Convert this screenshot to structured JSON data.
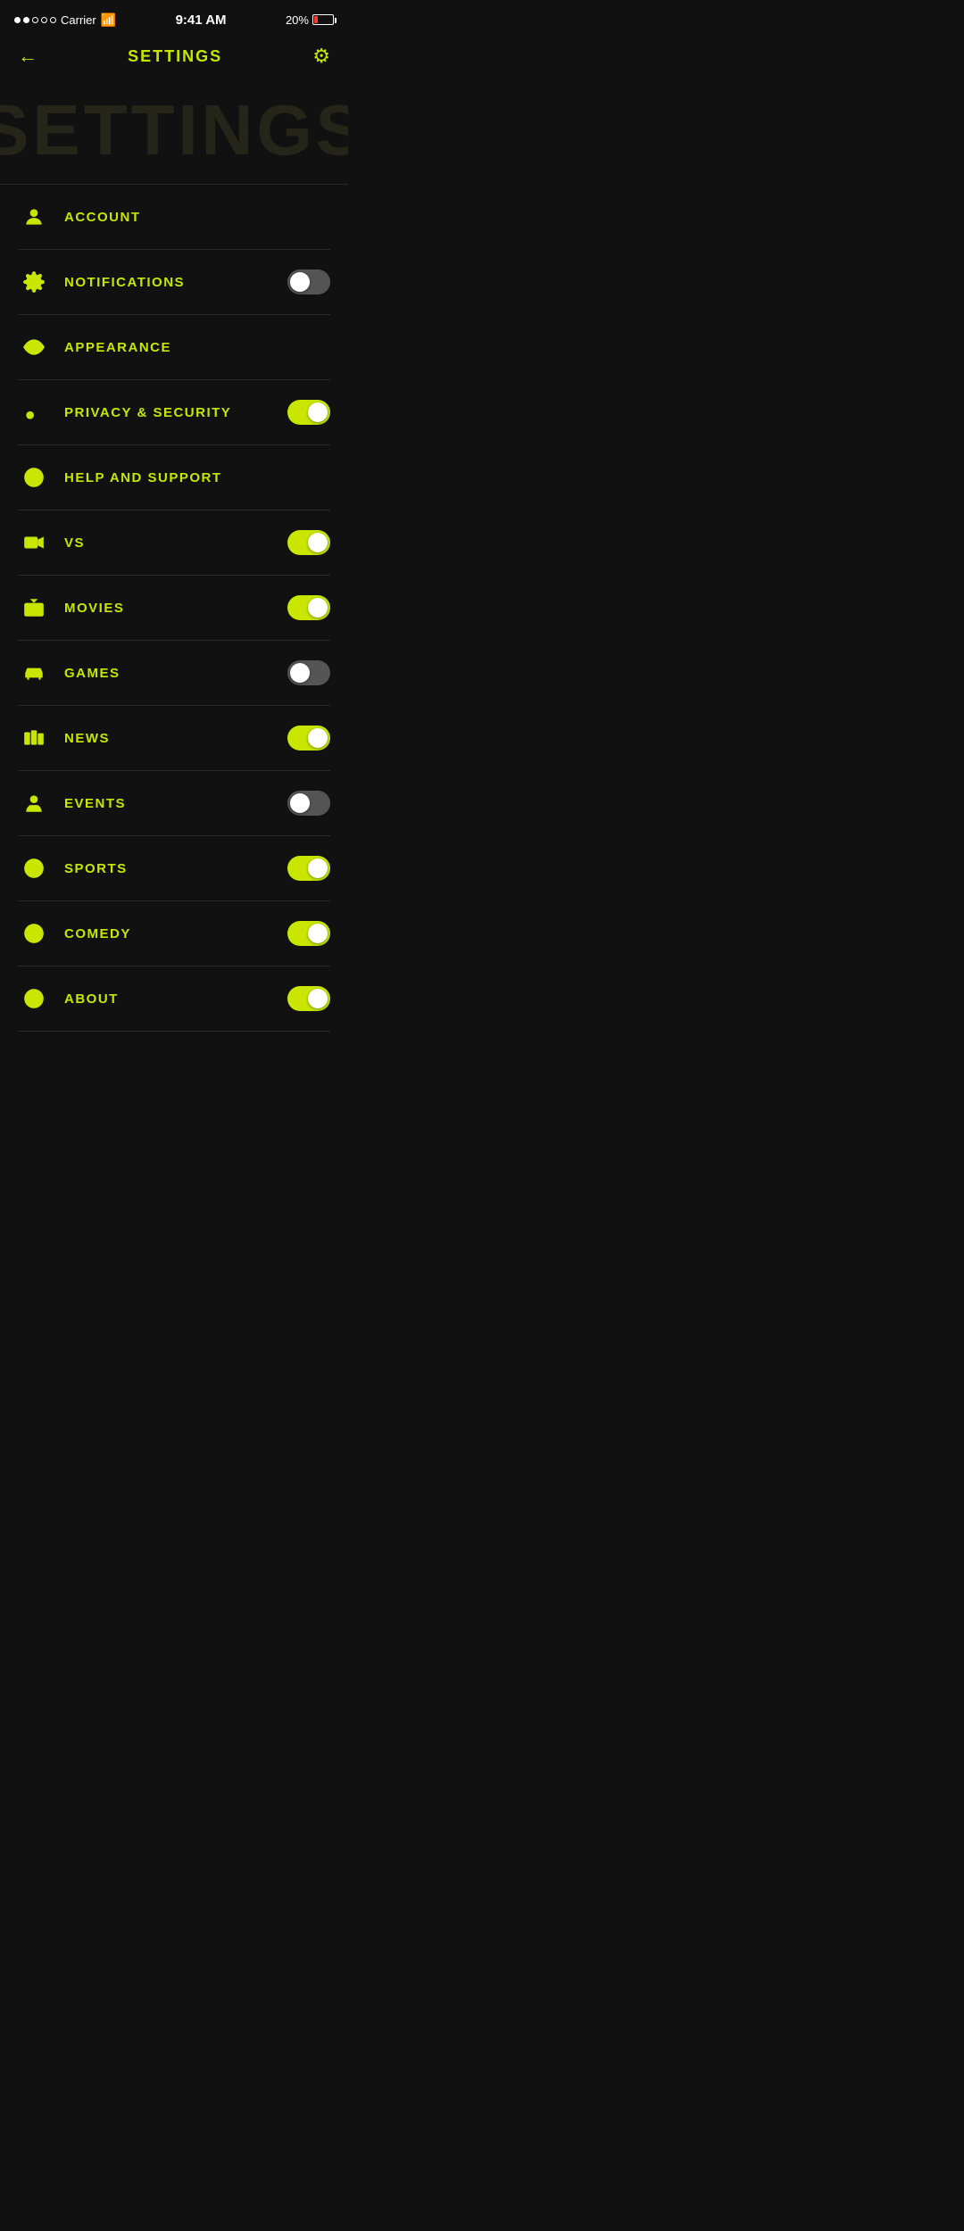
{
  "statusBar": {
    "carrier": "Carrier",
    "time": "9:41 AM",
    "battery": "20%"
  },
  "header": {
    "title": "SETTINGS",
    "bgText": "SETTINGS"
  },
  "items": [
    {
      "id": "account",
      "label": "ACCOUNT",
      "icon": "person",
      "toggle": null
    },
    {
      "id": "notifications",
      "label": "NOTIFICATIONS",
      "icon": "gear",
      "toggle": "off"
    },
    {
      "id": "appearance",
      "label": "APPEARANCE",
      "icon": "eye",
      "toggle": null
    },
    {
      "id": "privacy",
      "label": "PRIVACY & SECURITY",
      "icon": "key",
      "toggle": "on"
    },
    {
      "id": "help",
      "label": "HELP AND SUPPORT",
      "icon": "support",
      "toggle": null
    },
    {
      "id": "vs",
      "label": "VS",
      "icon": "camera",
      "toggle": "on"
    },
    {
      "id": "movies",
      "label": "MOVIES",
      "icon": "tv",
      "toggle": "on"
    },
    {
      "id": "games",
      "label": "GAMES",
      "icon": "car",
      "toggle": "off"
    },
    {
      "id": "news",
      "label": "NEWS",
      "icon": "books",
      "toggle": "on"
    },
    {
      "id": "events",
      "label": "EVENTS",
      "icon": "flag",
      "toggle": "off"
    },
    {
      "id": "sports",
      "label": "SPORTS",
      "icon": "soccer",
      "toggle": "on"
    },
    {
      "id": "comedy",
      "label": "COMEDY",
      "icon": "smile",
      "toggle": "on"
    },
    {
      "id": "about",
      "label": "ABOUT",
      "icon": "info",
      "toggle": "on"
    }
  ]
}
